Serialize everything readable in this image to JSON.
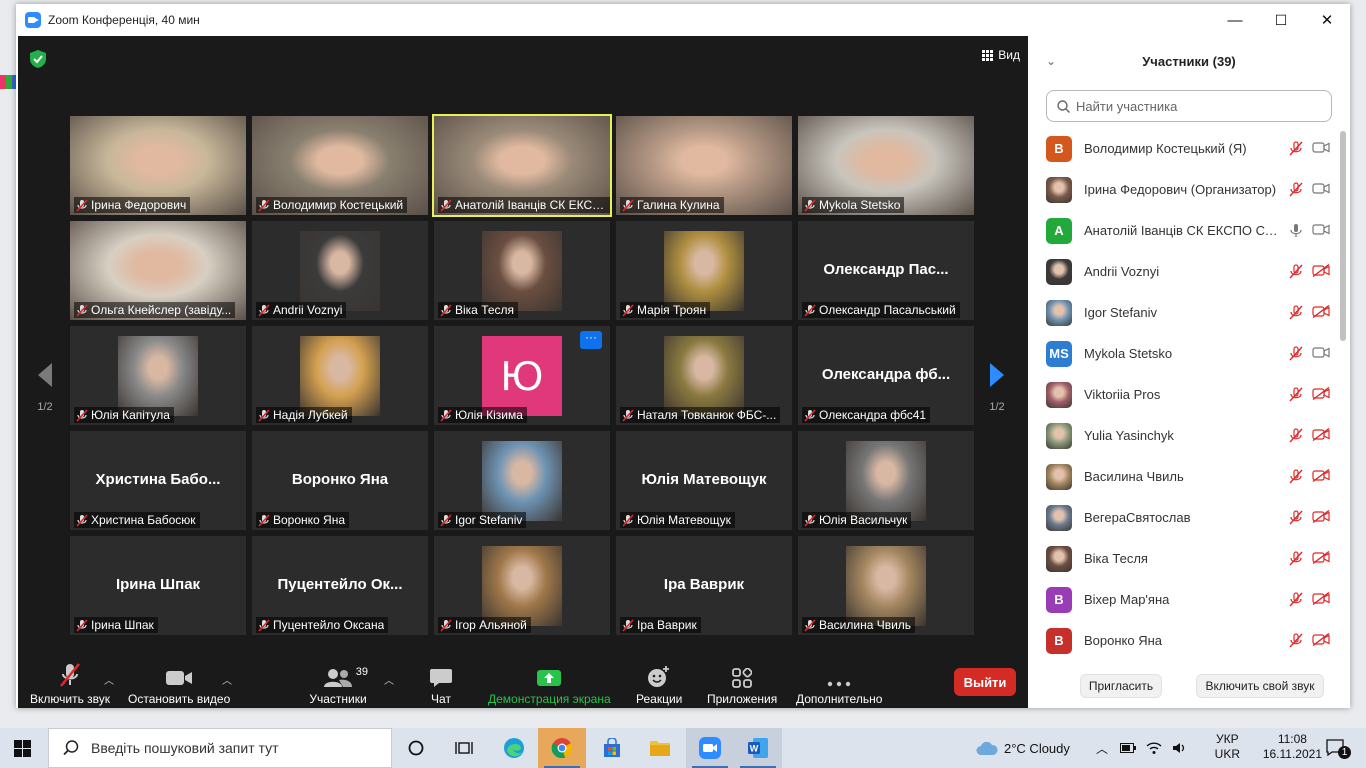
{
  "window": {
    "title": "Zoom Конференція, 40 мин",
    "minimize": "—",
    "maximize": "☐",
    "close": "✕"
  },
  "meeting": {
    "view_label": "Вид",
    "page_left": "1/2",
    "page_right": "1/2",
    "tiles": [
      {
        "caption": "Ірина Федорович",
        "kind": "photo",
        "photo_color": "#c8b79a"
      },
      {
        "caption": "Володимир Костецький",
        "kind": "photo",
        "photo_color": "#8a8070"
      },
      {
        "caption": "Анатолій Іванців СК ЕКСП...",
        "kind": "photo",
        "photo_color": "#9a8a78",
        "active": true
      },
      {
        "caption": "Галина Кулина",
        "kind": "photo",
        "photo_color": "#b79a86"
      },
      {
        "caption": "Mykola Stetsko",
        "kind": "photo",
        "photo_color": "#c9c5bd"
      },
      {
        "caption": "Ольга Кнейслер (завіду...",
        "kind": "photo",
        "photo_color": "#d8cfc3"
      },
      {
        "caption": "Andrii Voznyi",
        "kind": "avatar",
        "photo_color": "#3b3b3b"
      },
      {
        "caption": "Віка Тесля",
        "kind": "avatar",
        "photo_color": "#6b4e40"
      },
      {
        "caption": "Марія Троян",
        "kind": "avatar",
        "photo_color": "#b09040"
      },
      {
        "caption": "Олександр Пасальський",
        "kind": "name",
        "big": "Олександр  Пас..."
      },
      {
        "caption": "Юлія Капітула",
        "kind": "avatar",
        "photo_color": "#8a8a8a"
      },
      {
        "caption": "Надія Лубкей",
        "kind": "avatar",
        "photo_color": "#d4a050"
      },
      {
        "caption": "Юлія Кізима",
        "kind": "initial",
        "initial": "Ю",
        "menu": "···"
      },
      {
        "caption": "Наталя Товканюк ФБС-...",
        "kind": "avatar",
        "photo_color": "#8a7a40"
      },
      {
        "caption": "Олександра фбс41",
        "kind": "name",
        "big": "Олександра  фб..."
      },
      {
        "caption": "Христина Бабосюк",
        "kind": "name",
        "big": "Христина  Бабо..."
      },
      {
        "caption": "Воронко Яна",
        "kind": "name",
        "big": "Воронко Яна"
      },
      {
        "caption": "Igor Stefaniv",
        "kind": "avatar",
        "photo_color": "#6f94b4"
      },
      {
        "caption": "Юлія Матевощук",
        "kind": "name",
        "big": "Юлія Матевощук"
      },
      {
        "caption": "Юлія Васильчук",
        "kind": "avatar",
        "photo_color": "#777777"
      },
      {
        "caption": "Ірина Шпак",
        "kind": "name",
        "big": "Ірина Шпак"
      },
      {
        "caption": "Пуцентейло Оксана",
        "kind": "name",
        "big": "Пуцентейло  Ок..."
      },
      {
        "caption": "Ігор Альяной",
        "kind": "avatar",
        "photo_color": "#a0784a"
      },
      {
        "caption": "Іра Ваврик",
        "kind": "name",
        "big": "Іра Ваврик"
      },
      {
        "caption": "Василина Чвиль",
        "kind": "avatar",
        "photo_color": "#a48760"
      }
    ]
  },
  "toolbar": {
    "unmute": "Включить звук",
    "stop_video": "Остановить видео",
    "participants": "Участники",
    "participants_count": "39",
    "chat": "Чат",
    "share": "Демонстрация экрана",
    "reactions": "Реакции",
    "apps": "Приложения",
    "more": "Дополнительно",
    "leave": "Выйти"
  },
  "panel": {
    "title": "Участники (39)",
    "search_placeholder": "Найти участника",
    "participants": [
      {
        "name": "Володимир Костецький (Я)",
        "initial": "В",
        "color": "#d4571e",
        "mic": "muted",
        "cam": "on"
      },
      {
        "name": "Ірина Федорович (Организатор)",
        "initial": "",
        "color": "#7a5a4a",
        "mic": "muted",
        "cam": "on"
      },
      {
        "name": "Анатолій Іванців СК ЕКСПО СТ...",
        "initial": "A",
        "color": "#23a83b",
        "mic": "on",
        "cam": "on"
      },
      {
        "name": "Andrii Voznyi",
        "initial": "",
        "color": "#3b3b3b",
        "mic": "muted",
        "cam": "off"
      },
      {
        "name": "Igor Stefaniv",
        "initial": "",
        "color": "#6f94b4",
        "mic": "muted",
        "cam": "off"
      },
      {
        "name": "Mykola Stetsko",
        "initial": "MS",
        "color": "#2d7dd2",
        "mic": "muted",
        "cam": "on"
      },
      {
        "name": "Viktoriia Pros",
        "initial": "",
        "color": "#a0606a",
        "mic": "muted",
        "cam": "off"
      },
      {
        "name": "Yulia Yasinchyk",
        "initial": "",
        "color": "#8a9a7a",
        "mic": "muted",
        "cam": "off"
      },
      {
        "name": "Василина Чвиль",
        "initial": "",
        "color": "#a48760",
        "mic": "muted",
        "cam": "off"
      },
      {
        "name": "ВегераСвятослав",
        "initial": "",
        "color": "#6a7a90",
        "mic": "muted",
        "cam": "off"
      },
      {
        "name": "Віка Тесля",
        "initial": "",
        "color": "#6b4e40",
        "mic": "muted",
        "cam": "off"
      },
      {
        "name": "Віхер Мар'яна",
        "initial": "В",
        "color": "#9b3cb7",
        "mic": "muted",
        "cam": "off"
      },
      {
        "name": "Воронко Яна",
        "initial": "В",
        "color": "#c7302a",
        "mic": "muted",
        "cam": "off"
      }
    ],
    "invite": "Пригласить",
    "unmute_me": "Включить свой звук"
  },
  "taskbar": {
    "search_placeholder": "Введіть пошуковий запит тут",
    "weather": "2°C  Cloudy",
    "lang_top": "УКР",
    "lang_bottom": "UKR",
    "time": "11:08",
    "date": "16.11.2021",
    "notifications": "1"
  }
}
